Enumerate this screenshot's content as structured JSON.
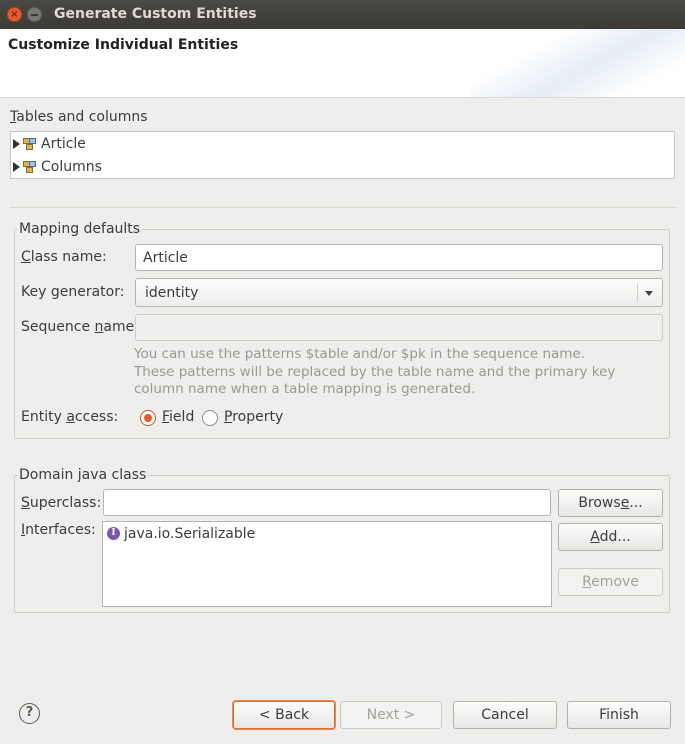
{
  "window": {
    "title": "Generate Custom Entities"
  },
  "header": {
    "title": "Customize Individual Entities"
  },
  "tables_section": {
    "label": "Tables and columns",
    "items": [
      {
        "label": "Article"
      },
      {
        "label": "Columns"
      }
    ]
  },
  "mapping": {
    "group_title": "Mapping defaults",
    "class_name_label": "Class name:",
    "class_name_value": "Article",
    "key_generator_label": "Key generator:",
    "key_generator_value": "identity",
    "sequence_name_label": "Sequence name:",
    "sequence_name_value": "",
    "hint_line1": "You can use the patterns $table and/or $pk in the sequence name.",
    "hint_line2": "These patterns will be replaced by the table name and the primary key",
    "hint_line3": "column name when a table mapping is generated.",
    "entity_access_label": "Entity access:",
    "field_option": "Field",
    "property_option": "Property",
    "selected_access": "Field"
  },
  "domain": {
    "group_title": "Domain java class",
    "superclass_label": "Superclass:",
    "superclass_value": "",
    "browse_label": "Browse...",
    "interfaces_label": "Interfaces:",
    "interfaces": [
      "java.io.Serializable"
    ],
    "add_label": "Add...",
    "remove_label": "Remove"
  },
  "footer": {
    "back_label": "< Back",
    "next_label": "Next >",
    "cancel_label": "Cancel",
    "finish_label": "Finish"
  },
  "colors": {
    "accent": "#e8592d",
    "titlebar": "#3b3a36"
  }
}
